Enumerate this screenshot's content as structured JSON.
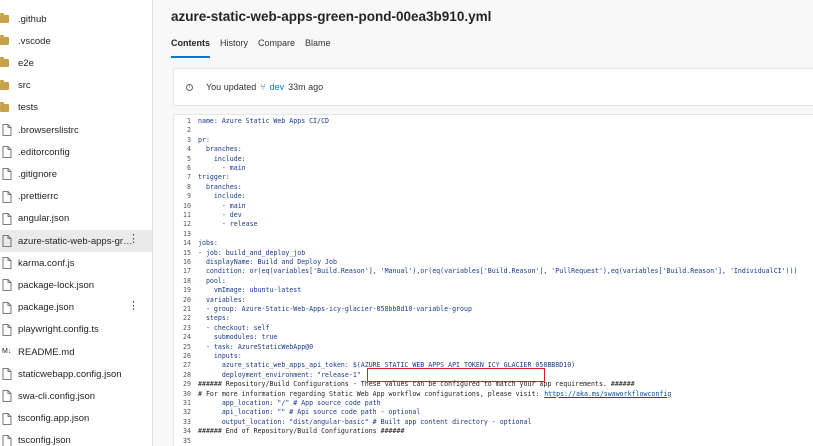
{
  "sidebar": {
    "items": [
      {
        "label": ".github",
        "type": "folder"
      },
      {
        "label": ".vscode",
        "type": "folder"
      },
      {
        "label": "e2e",
        "type": "folder"
      },
      {
        "label": "src",
        "type": "folder"
      },
      {
        "label": "tests",
        "type": "folder"
      },
      {
        "label": ".browserslistrc",
        "type": "file"
      },
      {
        "label": ".editorconfig",
        "type": "file"
      },
      {
        "label": ".gitignore",
        "type": "file"
      },
      {
        "label": ".prettierrc",
        "type": "file"
      },
      {
        "label": "angular.json",
        "type": "file"
      },
      {
        "label": "azure-static-web-apps-green-...",
        "type": "file",
        "selected": true,
        "more": "⋮"
      },
      {
        "label": "karma.conf.js",
        "type": "file"
      },
      {
        "label": "package-lock.json",
        "type": "file"
      },
      {
        "label": "package.json",
        "type": "file",
        "more": "⋮"
      },
      {
        "label": "playwright.config.ts",
        "type": "file"
      },
      {
        "label": "README.md",
        "type": "file",
        "icon": "markdown-icon"
      },
      {
        "label": "staticwebapp.config.json",
        "type": "file"
      },
      {
        "label": "swa-cli.config.json",
        "type": "file"
      },
      {
        "label": "tsconfig.app.json",
        "type": "file"
      },
      {
        "label": "tsconfig.json",
        "type": "file"
      }
    ]
  },
  "header": {
    "title": "azure-static-web-apps-green-pond-00ea3b910.yml",
    "tabs": [
      "Contents",
      "History",
      "Compare",
      "Blame"
    ],
    "active_tab": "Contents"
  },
  "banner": {
    "prefix": "You updated",
    "branch": "dev",
    "suffix": "33m ago"
  },
  "code": {
    "lines": [
      "name: Azure Static Web Apps CI/CD",
      "",
      "pr:",
      "  branches:",
      "    include:",
      "      - main",
      "trigger:",
      "  branches:",
      "    include:",
      "      - main",
      "      - dev",
      "      - release",
      "",
      "jobs:",
      "- job: build_and_deploy_job",
      "  displayName: Build and Deploy Job",
      "  condition: or(eq(variables['Build.Reason'], 'Manual'),or(eq(variables['Build.Reason'], 'PullRequest'),eq(variables['Build.Reason'], 'IndividualCI')))",
      "  pool:",
      "    vmImage: ubuntu-latest",
      "  variables:",
      "  - group: Azure-Static-Web-Apps-icy-glacier-058bb8d10-variable-group",
      "  steps:",
      "  - checkout: self",
      "    submodules: true",
      "  - task: AzureStaticWebApp@0",
      "    inputs:",
      "      azure_static_web_apps_api_token: $(AZURE_STATIC_WEB_APPS_API_TOKEN_ICY_GLACIER_058BB8D10)",
      "      deployment_environment: \"release-1\"",
      "###### Repository/Build Configurations - These values can be configured to match your app requirements. ######",
      "# For more information regarding Static Web App workflow configurations, please visit: ",
      "      app_location: \"/\" # App source code path",
      "      api_location: \"\" # Api source code path - optional",
      "      output_location: \"dist/angular-basic\" # Built app content directory - optional",
      "###### End of Repository/Build Configurations ######",
      ""
    ],
    "link_line_link": "https://aka.ms/swaworkflowconfig"
  }
}
